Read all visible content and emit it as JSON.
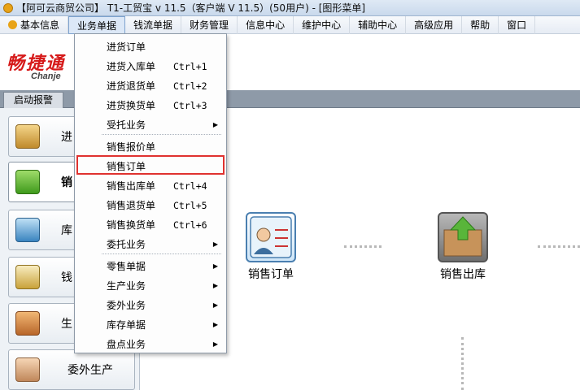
{
  "window": {
    "title": "【阿可云商贸公司】 T1-工贸宝 v 11.5（客户端 V 11.5）(50用户) - [图形菜单]"
  },
  "menubar": {
    "items": [
      "基本信息",
      "业务单据",
      "钱流单据",
      "财务管理",
      "信息中心",
      "维护中心",
      "辅助中心",
      "高级应用",
      "帮助",
      "窗口"
    ],
    "active": "业务单据"
  },
  "logo": {
    "cn": "畅捷通",
    "en": "Chanje"
  },
  "tab": {
    "label": "启动报警"
  },
  "sidebar": {
    "items": [
      {
        "label": "进",
        "icon": "purchase-icon"
      },
      {
        "label": "销",
        "icon": "basket-icon"
      },
      {
        "label": "库",
        "icon": "inventory-icon"
      },
      {
        "label": "钱",
        "icon": "money-icon"
      },
      {
        "label": "生",
        "icon": "production-icon"
      },
      {
        "label": "委外生产",
        "icon": "outsource-icon"
      }
    ]
  },
  "canvas": {
    "flow_items": [
      {
        "label": "销售订单",
        "icon": "sales-order-icon"
      },
      {
        "label": "销售出库",
        "icon": "sales-outbound-icon"
      }
    ]
  },
  "dropdown": {
    "items": [
      {
        "label": "进货订单",
        "shortcut": "",
        "submenu": false
      },
      {
        "label": "进货入库单",
        "shortcut": "Ctrl+1",
        "submenu": false
      },
      {
        "label": "进货退货单",
        "shortcut": "Ctrl+2",
        "submenu": false
      },
      {
        "label": "进货换货单",
        "shortcut": "Ctrl+3",
        "submenu": false
      },
      {
        "label": "受托业务",
        "shortcut": "",
        "submenu": true
      },
      {
        "label": "销售报价单",
        "shortcut": "",
        "submenu": false
      },
      {
        "label": "销售订单",
        "shortcut": "",
        "submenu": false,
        "highlighted": true
      },
      {
        "label": "销售出库单",
        "shortcut": "Ctrl+4",
        "submenu": false
      },
      {
        "label": "销售退货单",
        "shortcut": "Ctrl+5",
        "submenu": false
      },
      {
        "label": "销售换货单",
        "shortcut": "Ctrl+6",
        "submenu": false
      },
      {
        "label": "委托业务",
        "shortcut": "",
        "submenu": true
      },
      {
        "label": "零售单据",
        "shortcut": "",
        "submenu": true
      },
      {
        "label": "生产业务",
        "shortcut": "",
        "submenu": true
      },
      {
        "label": "委外业务",
        "shortcut": "",
        "submenu": true
      },
      {
        "label": "库存单据",
        "shortcut": "",
        "submenu": true
      },
      {
        "label": "盘点业务",
        "shortcut": "",
        "submenu": true
      }
    ]
  },
  "colors": {
    "highlight_border": "#e0322f",
    "logo_red": "#d61a1a"
  }
}
